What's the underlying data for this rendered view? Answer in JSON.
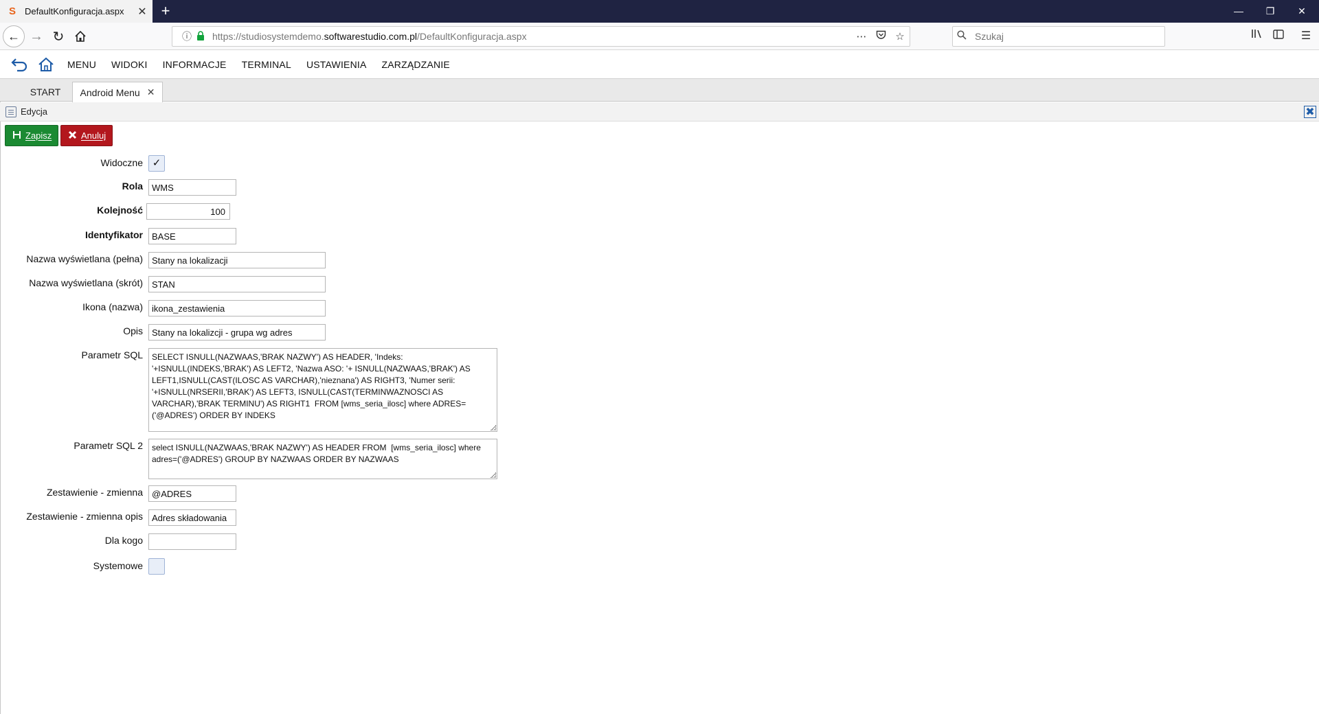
{
  "browser": {
    "tab_title": "DefaultKonfiguracja.aspx",
    "favicon": "S",
    "url_gray_prefix": "https://studiosystemdemo.",
    "url_domain": "softwarestudio.com.pl",
    "url_path": "/DefaultKonfiguracja.aspx",
    "search_placeholder": "Szukaj"
  },
  "app_menu": {
    "items": [
      "MENU",
      "WIDOKI",
      "INFORMACJE",
      "TERMINAL",
      "USTAWIENIA",
      "ZARZĄDZANIE"
    ]
  },
  "app_tabs": {
    "start": "START",
    "android": "Android Menu"
  },
  "panel": {
    "title": "Edycja"
  },
  "actions": {
    "save": "Zapisz",
    "cancel": "Anuluj"
  },
  "form": {
    "widoczne": {
      "label": "Widoczne",
      "checked": true,
      "mark": "✓"
    },
    "rola": {
      "label": "Rola",
      "value": "WMS"
    },
    "kolejnosc": {
      "label": "Kolejność",
      "value": "100"
    },
    "identyfikator": {
      "label": "Identyfikator",
      "value": "BASE"
    },
    "nazwa_pelna": {
      "label": "Nazwa wyświetlana (pełna)",
      "value": "Stany na lokalizacji"
    },
    "nazwa_skrot": {
      "label": "Nazwa wyświetlana (skrót)",
      "value": "STAN"
    },
    "ikona": {
      "label": "Ikona (nazwa)",
      "value": "ikona_zestawienia"
    },
    "opis": {
      "label": "Opis",
      "value": "Stany na lokalizcji - grupa wg adres"
    },
    "sql": {
      "label": "Parametr SQL",
      "value": "SELECT ISNULL(NAZWAAS,'BRAK NAZWY') AS HEADER, 'Indeks:\n'+ISNULL(INDEKS,'BRAK') AS LEFT2, 'Nazwa ASO: '+ ISNULL(NAZWAAS,'BRAK') AS\nLEFT1,ISNULL(CAST(ILOSC AS VARCHAR),'nieznana') AS RIGHT3, 'Numer serii:\n'+ISNULL(NRSERII,'BRAK') AS LEFT3, ISNULL(CAST(TERMINWAZNOSCI AS\nVARCHAR),'BRAK TERMINU') AS RIGHT1  FROM [wms_seria_ilosc] where ADRES=\n('@ADRES') ORDER BY INDEKS"
    },
    "sql2": {
      "label": "Parametr SQL 2",
      "value": "select ISNULL(NAZWAAS,'BRAK NAZWY') AS HEADER FROM  [wms_seria_ilosc] where\nadres=('@ADRES') GROUP BY NAZWAAS ORDER BY NAZWAAS"
    },
    "zm": {
      "label": "Zestawienie - zmienna",
      "value": "@ADRES"
    },
    "zm_opis": {
      "label": "Zestawienie - zmienna opis",
      "value": "Adres składowania"
    },
    "dla_kogo": {
      "label": "Dla kogo",
      "value": ""
    },
    "systemowe": {
      "label": "Systemowe",
      "checked": false
    }
  },
  "colors": {
    "titlebar": "#1f2342",
    "save_green": "#1b8a32",
    "cancel_red": "#b3171d",
    "menu_blue": "#1e5ca8"
  }
}
